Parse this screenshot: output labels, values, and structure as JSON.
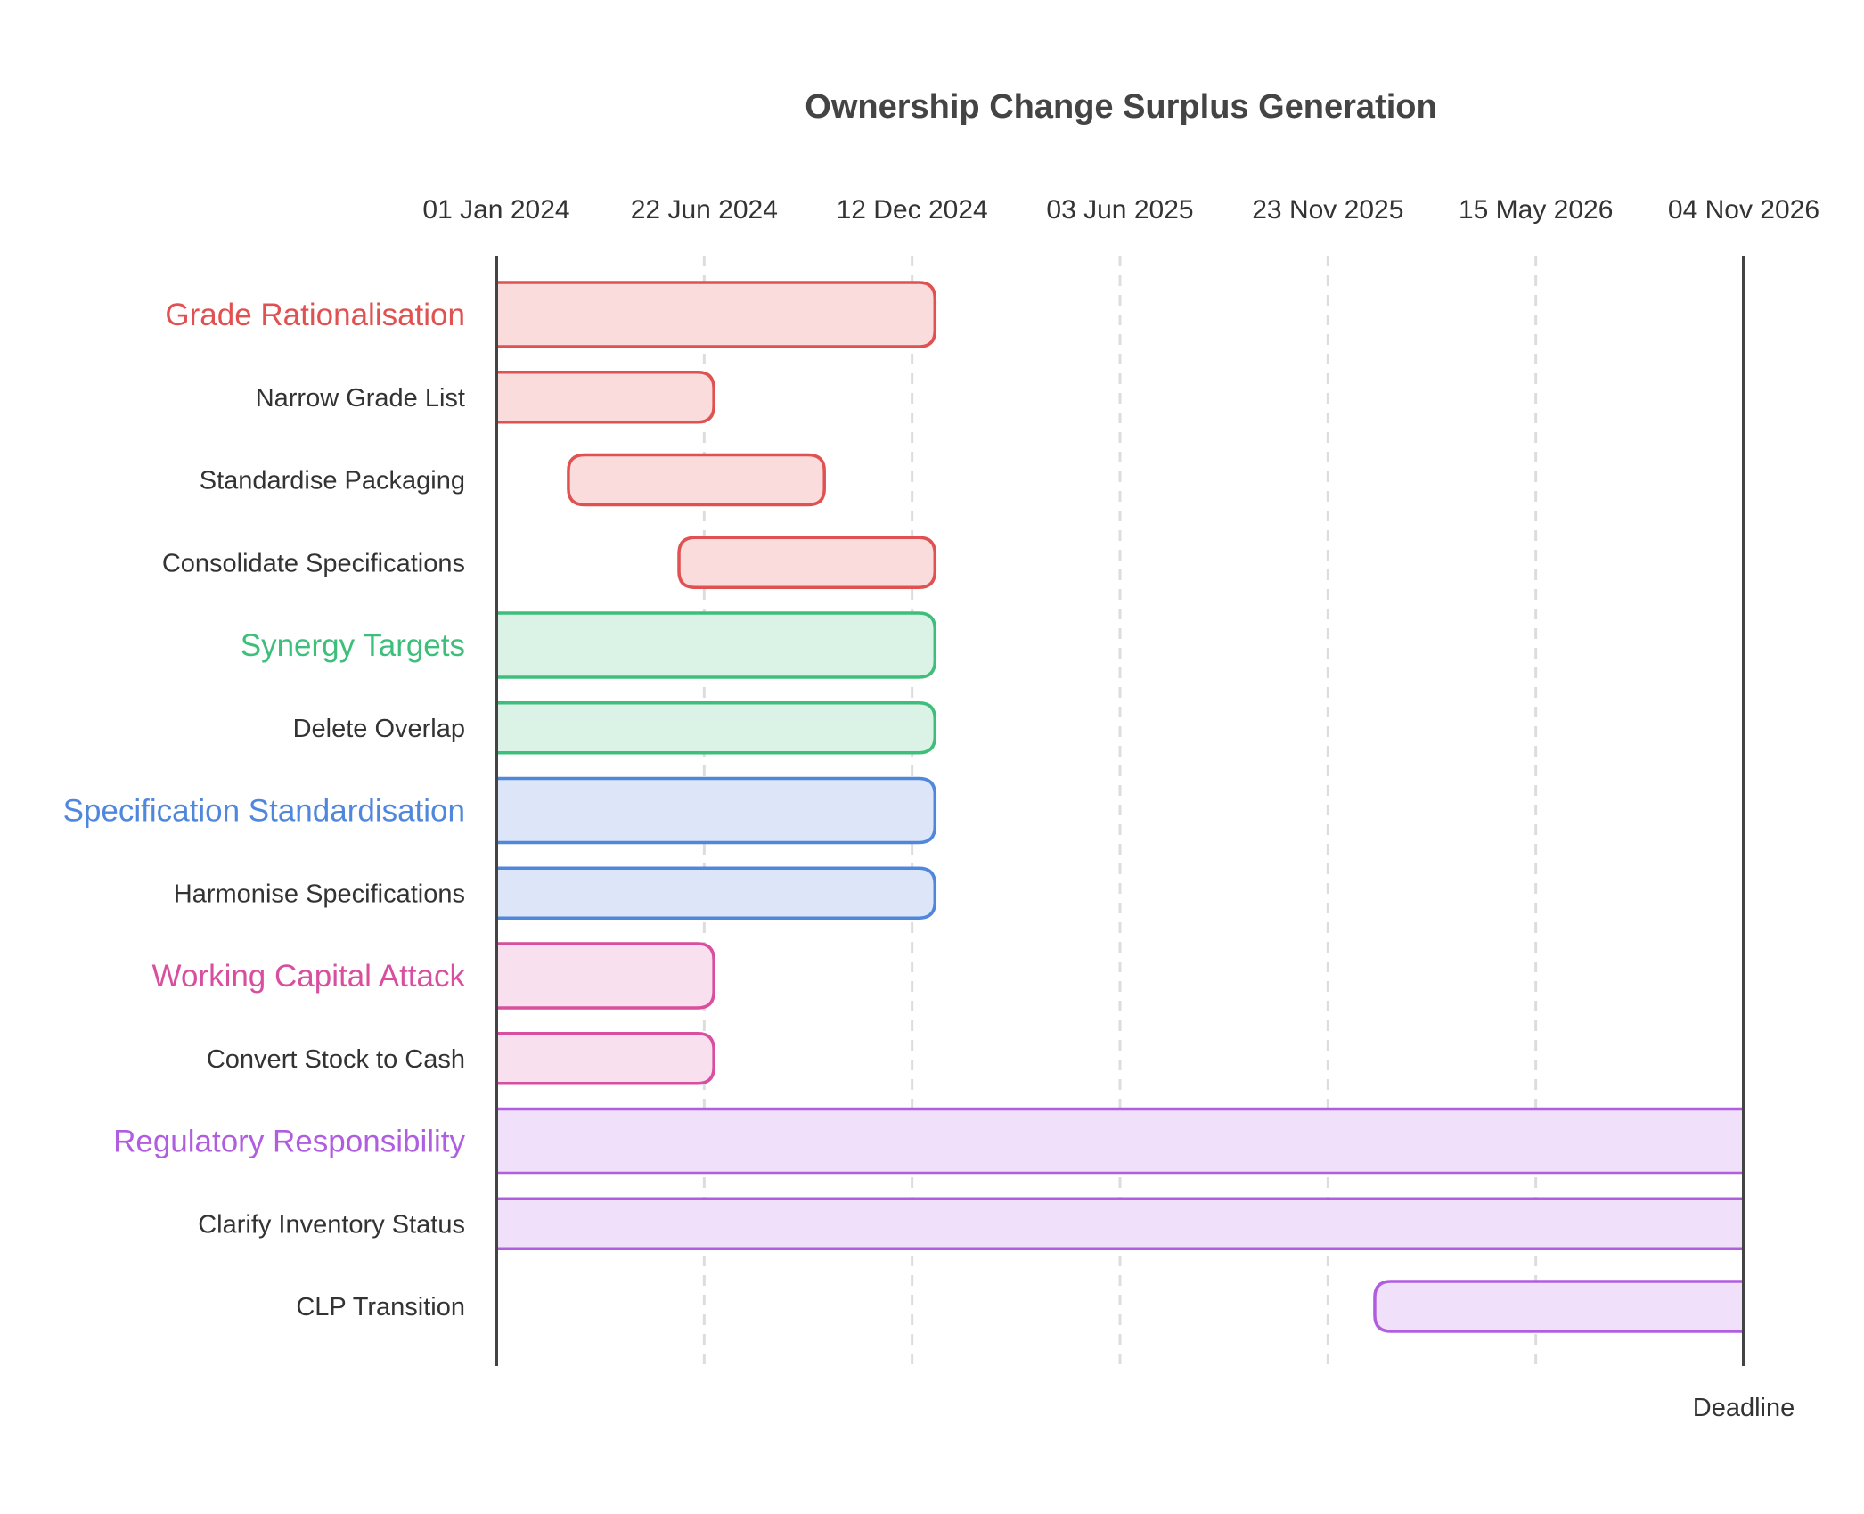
{
  "chart_data": {
    "type": "gantt",
    "title": "Ownership Change Surplus Generation",
    "x_axis": {
      "start": "2024-01-01",
      "end": "2026-11-04",
      "tick_labels": [
        "01 Jan 2024",
        "22 Jun 2024",
        "12 Dec 2024",
        "03 Jun 2025",
        "23 Nov 2025",
        "15 May 2026",
        "04 Nov 2026"
      ],
      "tick_dates": [
        "2024-01-01",
        "2024-06-22",
        "2024-12-12",
        "2025-06-03",
        "2025-11-23",
        "2026-05-15",
        "2026-11-04"
      ],
      "grid": "dashed vertical"
    },
    "colors": {
      "red": {
        "stroke": "#e05252",
        "fill": "#fadcdc"
      },
      "green": {
        "stroke": "#3dbf7b",
        "fill": "#daf3e6"
      },
      "blue": {
        "stroke": "#4f87dc",
        "fill": "#dce6f8"
      },
      "pink": {
        "stroke": "#d94fa0",
        "fill": "#f8e0ef"
      },
      "purple": {
        "stroke": "#b05ee0",
        "fill": "#f0e0fa"
      }
    },
    "rows": [
      {
        "label": "Grade Rationalisation",
        "kind": "group",
        "color": "red",
        "start": "2024-01-01",
        "end": "2024-12-31"
      },
      {
        "label": "Narrow Grade List",
        "kind": "task",
        "color": "red",
        "start": "2024-01-01",
        "end": "2024-06-30"
      },
      {
        "label": "Standardise Packaging",
        "kind": "task",
        "color": "red",
        "start": "2024-03-01",
        "end": "2024-09-30"
      },
      {
        "label": "Consolidate Specifications",
        "kind": "task",
        "color": "red",
        "start": "2024-06-01",
        "end": "2024-12-31"
      },
      {
        "label": "Synergy Targets",
        "kind": "group",
        "color": "green",
        "start": "2024-01-01",
        "end": "2024-12-31"
      },
      {
        "label": "Delete Overlap",
        "kind": "task",
        "color": "green",
        "start": "2024-01-01",
        "end": "2024-12-31"
      },
      {
        "label": "Specification Standardisation",
        "kind": "group",
        "color": "blue",
        "start": "2024-01-01",
        "end": "2024-12-31"
      },
      {
        "label": "Harmonise Specifications",
        "kind": "task",
        "color": "blue",
        "start": "2024-01-01",
        "end": "2024-12-31"
      },
      {
        "label": "Working Capital Attack",
        "kind": "group",
        "color": "pink",
        "start": "2024-01-01",
        "end": "2024-06-30"
      },
      {
        "label": "Convert Stock to Cash",
        "kind": "task",
        "color": "pink",
        "start": "2024-01-01",
        "end": "2024-06-30"
      },
      {
        "label": "Regulatory Responsibility",
        "kind": "group",
        "color": "purple",
        "start": "2024-01-01",
        "end": "2026-11-04"
      },
      {
        "label": "Clarify Inventory Status",
        "kind": "task",
        "color": "purple",
        "start": "2024-01-01",
        "end": "2026-11-04"
      },
      {
        "label": "CLP Transition",
        "kind": "task",
        "color": "purple",
        "start": "2026-01-01",
        "end": "2026-11-04"
      }
    ],
    "marker": {
      "label": "Deadline",
      "date": "2026-11-04"
    }
  }
}
